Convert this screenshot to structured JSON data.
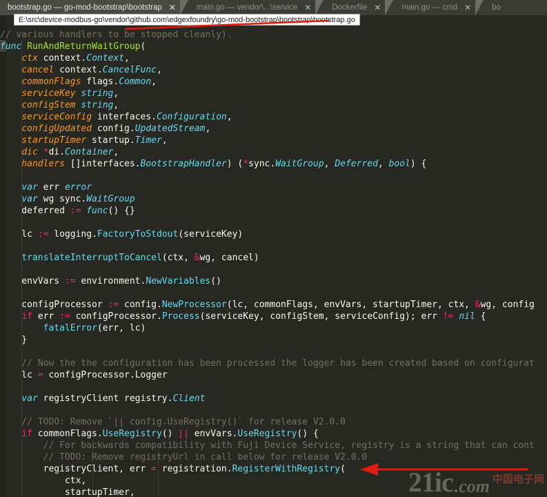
{
  "window": {
    "theme_background": "#272822",
    "tabbar_background": "#3b3c35",
    "active_tab_background": "#4a4b44"
  },
  "tabs": [
    {
      "label": "bootstrap.go — go-mod-bootstrap\\bootstrap",
      "close": "✕",
      "active": true
    },
    {
      "label": "main.go — vendor\\...\\service",
      "close": "✕",
      "active": false
    },
    {
      "label": "Dockerfile",
      "close": "✕",
      "active": false
    },
    {
      "label": "main.go — cmd",
      "close": "✕",
      "active": false
    },
    {
      "label": "bo",
      "close": "",
      "active": false
    }
  ],
  "tooltip": {
    "path": "E:\\src\\device-modbus-go\\vendor\\github.com\\edgexfoundry\\go-mod-bootstrap\\bootstrap\\bootstrap.go"
  },
  "annotations": {
    "color": "#e01b0f",
    "line_strike_label": "strikethrough-over-comment",
    "arrow_label": "arrow-pointing-to-RegisterWithRegistry"
  },
  "watermark": {
    "main": "21ic",
    "dotcom": ".com",
    "chinese": "中国电子网"
  },
  "code": {
    "language": "go",
    "lines": [
      {
        "segs": [
          {
            "t": "// various handlers to be stopped cleanly).",
            "c": "cmt"
          }
        ]
      },
      {
        "segs": [
          {
            "t": "func ",
            "c": "kw"
          },
          {
            "t": "RunAndReturnWaitGroup",
            "c": "fn"
          },
          {
            "t": "(",
            "c": "pl"
          }
        ]
      },
      {
        "segs": [
          {
            "t": "    ",
            "c": "pl"
          },
          {
            "t": "ctx",
            "c": "param"
          },
          {
            "t": " context.",
            "c": "pl"
          },
          {
            "t": "Context",
            "c": "type"
          },
          {
            "t": ",",
            "c": "pl"
          }
        ]
      },
      {
        "segs": [
          {
            "t": "    ",
            "c": "pl"
          },
          {
            "t": "cancel",
            "c": "param"
          },
          {
            "t": " context.",
            "c": "pl"
          },
          {
            "t": "CancelFunc",
            "c": "type"
          },
          {
            "t": ",",
            "c": "pl"
          }
        ]
      },
      {
        "segs": [
          {
            "t": "    ",
            "c": "pl"
          },
          {
            "t": "commonFlags",
            "c": "param"
          },
          {
            "t": " flags.",
            "c": "pl"
          },
          {
            "t": "Common",
            "c": "type"
          },
          {
            "t": ",",
            "c": "pl"
          }
        ]
      },
      {
        "segs": [
          {
            "t": "    ",
            "c": "pl"
          },
          {
            "t": "serviceKey",
            "c": "param"
          },
          {
            "t": " ",
            "c": "pl"
          },
          {
            "t": "string",
            "c": "type"
          },
          {
            "t": ",",
            "c": "pl"
          }
        ]
      },
      {
        "segs": [
          {
            "t": "    ",
            "c": "pl"
          },
          {
            "t": "configStem",
            "c": "param"
          },
          {
            "t": " ",
            "c": "pl"
          },
          {
            "t": "string",
            "c": "type"
          },
          {
            "t": ",",
            "c": "pl"
          }
        ]
      },
      {
        "segs": [
          {
            "t": "    ",
            "c": "pl"
          },
          {
            "t": "serviceConfig",
            "c": "param"
          },
          {
            "t": " interfaces.",
            "c": "pl"
          },
          {
            "t": "Configuration",
            "c": "type"
          },
          {
            "t": ",",
            "c": "pl"
          }
        ]
      },
      {
        "segs": [
          {
            "t": "    ",
            "c": "pl"
          },
          {
            "t": "configUpdated",
            "c": "param"
          },
          {
            "t": " config.",
            "c": "pl"
          },
          {
            "t": "UpdatedStream",
            "c": "type"
          },
          {
            "t": ",",
            "c": "pl"
          }
        ]
      },
      {
        "segs": [
          {
            "t": "    ",
            "c": "pl"
          },
          {
            "t": "startupTimer",
            "c": "param"
          },
          {
            "t": " startup.",
            "c": "pl"
          },
          {
            "t": "Timer",
            "c": "type"
          },
          {
            "t": ",",
            "c": "pl"
          }
        ]
      },
      {
        "segs": [
          {
            "t": "    ",
            "c": "pl"
          },
          {
            "t": "dic",
            "c": "param"
          },
          {
            "t": " ",
            "c": "pl"
          },
          {
            "t": "*",
            "c": "op"
          },
          {
            "t": "di.",
            "c": "pl"
          },
          {
            "t": "Container",
            "c": "type"
          },
          {
            "t": ",",
            "c": "pl"
          }
        ]
      },
      {
        "segs": [
          {
            "t": "    ",
            "c": "pl"
          },
          {
            "t": "handlers",
            "c": "param"
          },
          {
            "t": " []interfaces.",
            "c": "pl"
          },
          {
            "t": "BootstrapHandler",
            "c": "type"
          },
          {
            "t": ") (",
            "c": "pl"
          },
          {
            "t": "*",
            "c": "op"
          },
          {
            "t": "sync.",
            "c": "pl"
          },
          {
            "t": "WaitGroup",
            "c": "type"
          },
          {
            "t": ", ",
            "c": "pl"
          },
          {
            "t": "Deferred",
            "c": "type"
          },
          {
            "t": ", ",
            "c": "pl"
          },
          {
            "t": "bool",
            "c": "type"
          },
          {
            "t": ") {",
            "c": "pl"
          }
        ]
      },
      {
        "segs": []
      },
      {
        "segs": [
          {
            "t": "    ",
            "c": "pl"
          },
          {
            "t": "var",
            "c": "kw"
          },
          {
            "t": " err ",
            "c": "pl"
          },
          {
            "t": "error",
            "c": "type"
          }
        ]
      },
      {
        "segs": [
          {
            "t": "    ",
            "c": "pl"
          },
          {
            "t": "var",
            "c": "kw"
          },
          {
            "t": " wg sync.",
            "c": "pl"
          },
          {
            "t": "WaitGroup",
            "c": "type"
          }
        ]
      },
      {
        "segs": [
          {
            "t": "    deferred ",
            "c": "pl"
          },
          {
            "t": ":=",
            "c": "op"
          },
          {
            "t": " ",
            "c": "pl"
          },
          {
            "t": "func",
            "c": "kw"
          },
          {
            "t": "() {}",
            "c": "pl"
          }
        ]
      },
      {
        "segs": []
      },
      {
        "segs": [
          {
            "t": "    lc ",
            "c": "pl"
          },
          {
            "t": ":=",
            "c": "op"
          },
          {
            "t": " logging.",
            "c": "pl"
          },
          {
            "t": "FactoryToStdout",
            "c": "call"
          },
          {
            "t": "(serviceKey)",
            "c": "pl"
          }
        ]
      },
      {
        "segs": []
      },
      {
        "segs": [
          {
            "t": "    ",
            "c": "pl"
          },
          {
            "t": "translateInterruptToCancel",
            "c": "call"
          },
          {
            "t": "(ctx, ",
            "c": "pl"
          },
          {
            "t": "&",
            "c": "op"
          },
          {
            "t": "wg, cancel)",
            "c": "pl"
          }
        ]
      },
      {
        "segs": []
      },
      {
        "segs": [
          {
            "t": "    envVars ",
            "c": "pl"
          },
          {
            "t": ":=",
            "c": "op"
          },
          {
            "t": " environment.",
            "c": "pl"
          },
          {
            "t": "NewVariables",
            "c": "call"
          },
          {
            "t": "()",
            "c": "pl"
          }
        ]
      },
      {
        "segs": []
      },
      {
        "segs": [
          {
            "t": "    configProcessor ",
            "c": "pl"
          },
          {
            "t": ":=",
            "c": "op"
          },
          {
            "t": " config.",
            "c": "pl"
          },
          {
            "t": "NewProcessor",
            "c": "call"
          },
          {
            "t": "(lc, commonFlags, envVars, startupTimer, ctx, ",
            "c": "pl"
          },
          {
            "t": "&",
            "c": "op"
          },
          {
            "t": "wg, config",
            "c": "pl"
          }
        ]
      },
      {
        "segs": [
          {
            "t": "    ",
            "c": "pl"
          },
          {
            "t": "if",
            "c": "kw2"
          },
          {
            "t": " err ",
            "c": "pl"
          },
          {
            "t": ":=",
            "c": "op"
          },
          {
            "t": " configProcessor.",
            "c": "pl"
          },
          {
            "t": "Process",
            "c": "call"
          },
          {
            "t": "(serviceKey, configStem, serviceConfig); err ",
            "c": "pl"
          },
          {
            "t": "!=",
            "c": "op"
          },
          {
            "t": " ",
            "c": "pl"
          },
          {
            "t": "nil",
            "c": "kw"
          },
          {
            "t": " {",
            "c": "pl"
          }
        ]
      },
      {
        "segs": [
          {
            "t": "        ",
            "c": "pl"
          },
          {
            "t": "fatalError",
            "c": "call"
          },
          {
            "t": "(err, lc)",
            "c": "pl"
          }
        ]
      },
      {
        "segs": [
          {
            "t": "    }",
            "c": "pl"
          }
        ]
      },
      {
        "segs": []
      },
      {
        "segs": [
          {
            "t": "    // Now the the configuration has been processed the logger has been created based on configurat",
            "c": "cmt"
          }
        ]
      },
      {
        "segs": [
          {
            "t": "    lc ",
            "c": "pl"
          },
          {
            "t": "=",
            "c": "op"
          },
          {
            "t": " configProcessor.",
            "c": "pl"
          },
          {
            "t": "Logger",
            "c": "pl"
          }
        ]
      },
      {
        "segs": []
      },
      {
        "segs": [
          {
            "t": "    ",
            "c": "pl"
          },
          {
            "t": "var",
            "c": "kw"
          },
          {
            "t": " registryClient registry.",
            "c": "pl"
          },
          {
            "t": "Client",
            "c": "type"
          }
        ]
      },
      {
        "segs": []
      },
      {
        "segs": [
          {
            "t": "    // TODO: Remove `|| config.UseRegistry()` for release V2.0.0",
            "c": "cmt"
          }
        ]
      },
      {
        "segs": [
          {
            "t": "    ",
            "c": "pl"
          },
          {
            "t": "if",
            "c": "kw2"
          },
          {
            "t": " commonFlags.",
            "c": "pl"
          },
          {
            "t": "UseRegistry",
            "c": "call"
          },
          {
            "t": "() ",
            "c": "pl"
          },
          {
            "t": "||",
            "c": "op"
          },
          {
            "t": " envVars.",
            "c": "pl"
          },
          {
            "t": "UseRegistry",
            "c": "call"
          },
          {
            "t": "() {",
            "c": "pl"
          }
        ]
      },
      {
        "segs": [
          {
            "t": "        // For backwards compatibility with Fuji Device Service, registry is a string that can cont",
            "c": "cmt"
          }
        ]
      },
      {
        "segs": [
          {
            "t": "        // TODO: Remove registryUrl in call below for release V2.0.0",
            "c": "cmt"
          }
        ]
      },
      {
        "segs": [
          {
            "t": "        registryClient, err ",
            "c": "pl"
          },
          {
            "t": "=",
            "c": "op"
          },
          {
            "t": " registration.",
            "c": "pl"
          },
          {
            "t": "RegisterWithRegistry",
            "c": "call"
          },
          {
            "t": "(",
            "c": "pl"
          }
        ]
      },
      {
        "segs": [
          {
            "t": "            ctx,",
            "c": "pl"
          }
        ]
      },
      {
        "segs": [
          {
            "t": "            startupTimer,",
            "c": "pl"
          }
        ]
      }
    ]
  }
}
